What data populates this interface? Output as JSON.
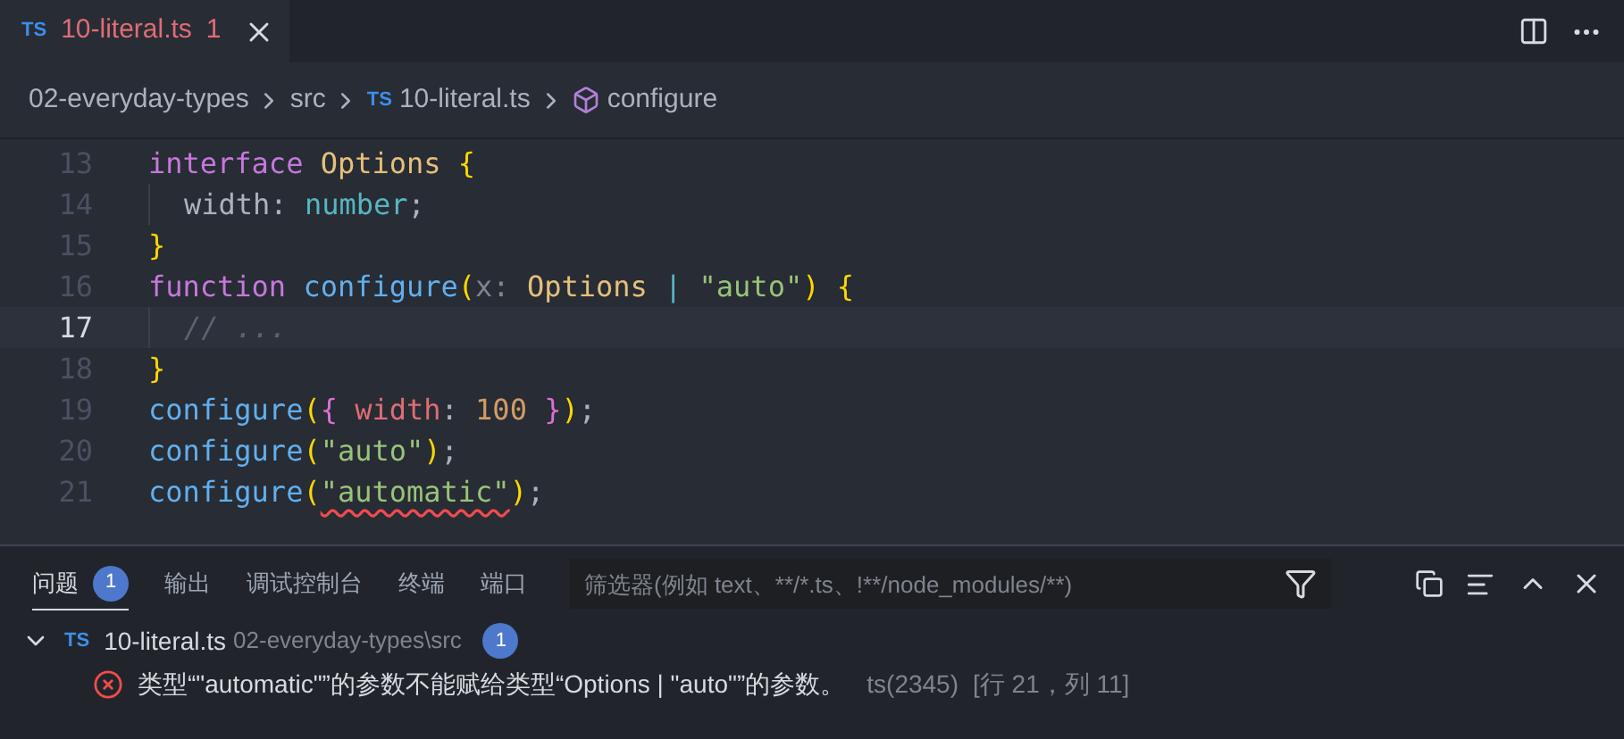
{
  "editor_tabs": [
    {
      "icon_text": "TS",
      "label": "10-literal.ts",
      "problem_count": "1",
      "selected": true,
      "has_error": true
    }
  ],
  "breadcrumb": [
    {
      "kind": "folder",
      "label": "02-everyday-types"
    },
    {
      "kind": "folder",
      "label": "src"
    },
    {
      "kind": "file",
      "icon_text": "TS",
      "label": "10-literal.ts"
    },
    {
      "kind": "symbol",
      "label": "configure"
    }
  ],
  "code_lines": [
    {
      "number": "13",
      "current": false,
      "indented": false,
      "tokens": [
        {
          "kind": "keyword",
          "text": "interface "
        },
        {
          "kind": "type",
          "text": "Options "
        },
        {
          "kind": "brace",
          "text": "{"
        }
      ]
    },
    {
      "number": "14",
      "current": false,
      "indented": true,
      "tokens": [
        {
          "kind": "plain",
          "text": "width: "
        },
        {
          "kind": "builtin",
          "text": "number"
        },
        {
          "kind": "plain",
          "text": ";"
        }
      ]
    },
    {
      "number": "15",
      "current": false,
      "indented": false,
      "tokens": [
        {
          "kind": "brace",
          "text": "}"
        }
      ]
    },
    {
      "number": "16",
      "current": false,
      "indented": false,
      "tokens": [
        {
          "kind": "keyword",
          "text": "function "
        },
        {
          "kind": "function",
          "text": "configure"
        },
        {
          "kind": "brace",
          "text": "("
        },
        {
          "kind": "param",
          "text": "x: "
        },
        {
          "kind": "type",
          "text": "Options "
        },
        {
          "kind": "builtin",
          "text": "| "
        },
        {
          "kind": "string",
          "text": "\"auto\""
        },
        {
          "kind": "brace",
          "text": ") {"
        }
      ]
    },
    {
      "number": "17",
      "current": true,
      "indented": true,
      "tokens": [
        {
          "kind": "comment",
          "text": "// ..."
        }
      ]
    },
    {
      "number": "18",
      "current": false,
      "indented": false,
      "tokens": [
        {
          "kind": "brace",
          "text": "}"
        }
      ]
    },
    {
      "number": "19",
      "current": false,
      "indented": false,
      "tokens": [
        {
          "kind": "function",
          "text": "configure"
        },
        {
          "kind": "brace",
          "text": "("
        },
        {
          "kind": "brace2",
          "text": "{ "
        },
        {
          "kind": "property",
          "text": "width"
        },
        {
          "kind": "plain",
          "text": ": "
        },
        {
          "kind": "number",
          "text": "100"
        },
        {
          "kind": "brace2",
          "text": " }"
        },
        {
          "kind": "brace",
          "text": ")"
        },
        {
          "kind": "plain",
          "text": ";"
        }
      ]
    },
    {
      "number": "20",
      "current": false,
      "indented": false,
      "tokens": [
        {
          "kind": "function",
          "text": "configure"
        },
        {
          "kind": "brace",
          "text": "("
        },
        {
          "kind": "string",
          "text": "\"auto\""
        },
        {
          "kind": "brace",
          "text": ")"
        },
        {
          "kind": "plain",
          "text": ";"
        }
      ]
    },
    {
      "number": "21",
      "current": false,
      "indented": false,
      "tokens": [
        {
          "kind": "function",
          "text": "configure"
        },
        {
          "kind": "brace",
          "text": "("
        },
        {
          "kind": "string",
          "text": "\"automatic\"",
          "error": true
        },
        {
          "kind": "brace",
          "text": ")"
        },
        {
          "kind": "plain",
          "text": ";"
        }
      ]
    }
  ],
  "panel": {
    "tabs": [
      {
        "label": "问题",
        "badge": "1",
        "selected": true
      },
      {
        "label": "输出",
        "selected": false
      },
      {
        "label": "调试控制台",
        "selected": false
      },
      {
        "label": "终端",
        "selected": false
      },
      {
        "label": "端口",
        "selected": false
      }
    ],
    "filter": {
      "placeholder": "筛选器(例如 text、**/*.ts、!**/node_modules/**)"
    },
    "problem_groups": [
      {
        "expanded": true,
        "icon_text": "TS",
        "file": "10-literal.ts",
        "path": "02-everyday-types\\src",
        "count": "1",
        "problems": [
          {
            "kind": "error",
            "message": "类型“\"automatic\"”的参数不能赋给类型“Options | \"auto\"”的参数。",
            "code": "ts(2345)",
            "location": "[行 21，列 11]"
          }
        ]
      }
    ]
  }
}
